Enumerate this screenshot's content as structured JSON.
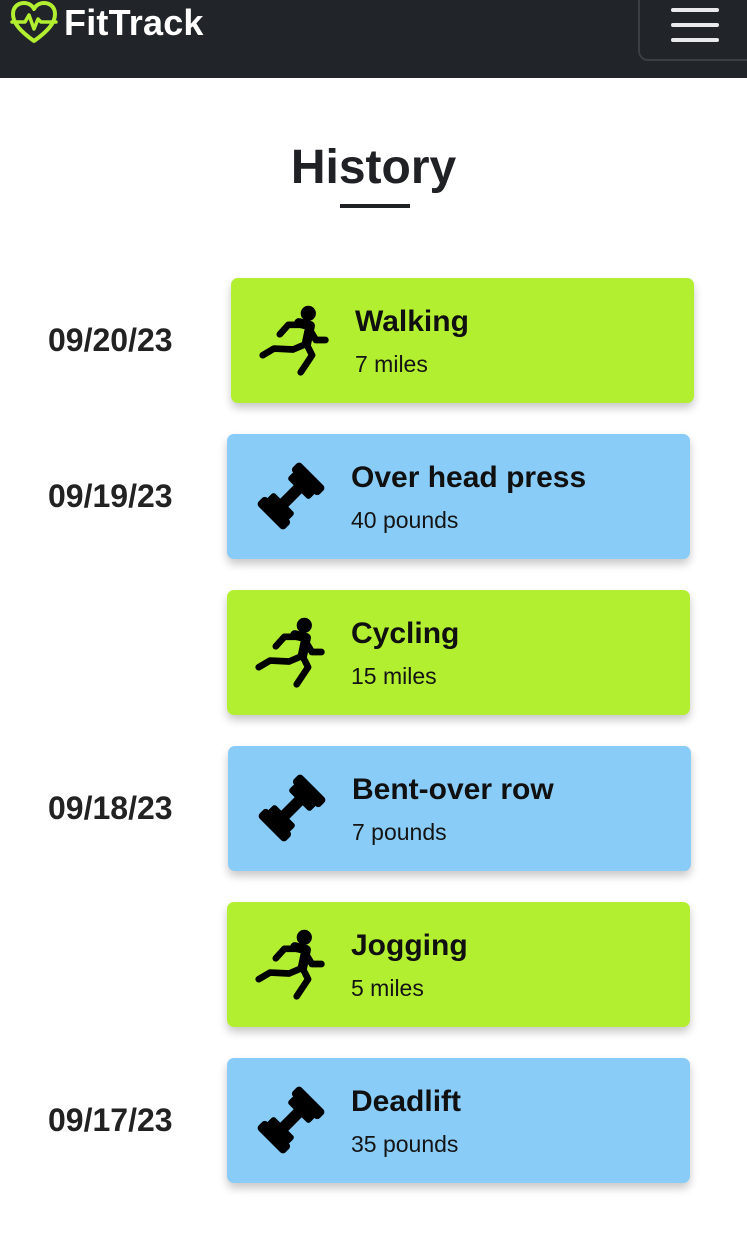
{
  "app": {
    "brand": "FitTrack",
    "accent": "#b3ef31",
    "header_bg": "#212529"
  },
  "header": {
    "menu_icon": "hamburger-menu-icon"
  },
  "page": {
    "title": "History"
  },
  "colors": {
    "cardio": "#b3ef31",
    "strength": "#88ccf7"
  },
  "history": {
    "dates": [
      "09/20/23",
      "09/19/23",
      "09/18/23",
      "09/17/23"
    ],
    "entries": [
      {
        "name": "Walking",
        "amount": "7 miles",
        "type": "cardio",
        "icon": "running-person-icon"
      },
      {
        "name": "Over head press",
        "amount": "40 pounds",
        "type": "strength",
        "icon": "dumbbell-icon"
      },
      {
        "name": "Cycling",
        "amount": "15 miles",
        "type": "cardio",
        "icon": "running-person-icon"
      },
      {
        "name": "Bent-over row",
        "amount": "7 pounds",
        "type": "strength",
        "icon": "dumbbell-icon"
      },
      {
        "name": "Jogging",
        "amount": "5 miles",
        "type": "cardio",
        "icon": "running-person-icon"
      },
      {
        "name": "Deadlift",
        "amount": "35 pounds",
        "type": "strength",
        "icon": "dumbbell-icon"
      }
    ]
  }
}
